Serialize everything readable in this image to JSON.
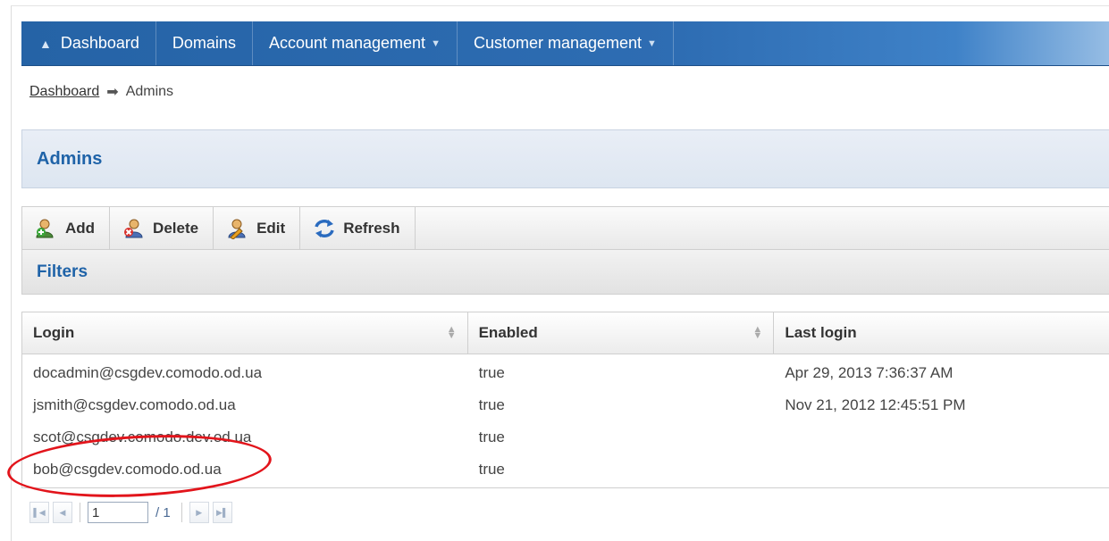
{
  "nav": {
    "items": [
      {
        "label": "Dashboard",
        "icon": "home-icon"
      },
      {
        "label": "Domains"
      },
      {
        "label": "Account management",
        "dropdown": true
      },
      {
        "label": "Customer management",
        "dropdown": true
      }
    ]
  },
  "breadcrumb": {
    "link": "Dashboard",
    "separator_icon": "arrow-right-icon",
    "current": "Admins"
  },
  "page": {
    "title": "Admins"
  },
  "toolbar": {
    "add_label": "Add",
    "delete_label": "Delete",
    "edit_label": "Edit",
    "refresh_label": "Refresh"
  },
  "filters": {
    "label": "Filters"
  },
  "table": {
    "columns": [
      "Login",
      "Enabled",
      "Last login"
    ],
    "rows": [
      {
        "login": "docadmin@csgdev.comodo.od.ua",
        "enabled": "true",
        "last_login": "Apr 29, 2013 7:36:37 AM"
      },
      {
        "login": "jsmith@csgdev.comodo.od.ua",
        "enabled": "true",
        "last_login": "Nov 21, 2012 12:45:51 PM"
      },
      {
        "login": "scot@csgdev.comodo.dev.od.ua",
        "enabled": "true",
        "last_login": ""
      },
      {
        "login": "bob@csgdev.comodo.od.ua",
        "enabled": "true",
        "last_login": ""
      }
    ]
  },
  "pager": {
    "current_page": "1",
    "total": "/ 1"
  },
  "colors": {
    "nav_bg": "#2563a6",
    "title_text": "#1f63a8",
    "highlight_ellipse": "#e2141b"
  }
}
